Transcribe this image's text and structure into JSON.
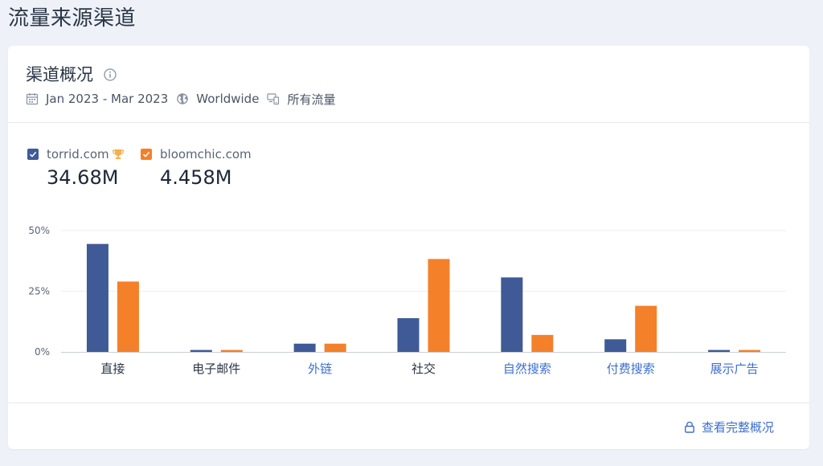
{
  "page": {
    "title": "流量来源渠道"
  },
  "card": {
    "title": "渠道概况",
    "filters": {
      "date_range": "Jan 2023 - Mar 2023",
      "region": "Worldwide",
      "traffic": "所有流量"
    },
    "footer_link": "查看完整概况"
  },
  "legend": [
    {
      "site": "torrid.com",
      "value": "34.68M",
      "color": "#3f5a97",
      "checked": true,
      "trophy": true
    },
    {
      "site": "bloomchic.com",
      "value": "4.458M",
      "color": "#f4802a",
      "checked": true,
      "trophy": false
    }
  ],
  "colors": {
    "series_1": "#3f5a97",
    "series_2": "#f4802a",
    "link": "#3d6fd0",
    "trophy": "#f3b24a"
  },
  "icons": {
    "info": "info-icon",
    "calendar": "calendar-icon",
    "globe": "globe-icon",
    "traffic": "devices-icon",
    "trophy": "trophy-icon",
    "lock": "lock-icon"
  },
  "chart_data": {
    "type": "bar",
    "categories": [
      "直接",
      "电子邮件",
      "外链",
      "社交",
      "自然搜索",
      "付费搜索",
      "展示广告"
    ],
    "category_is_link": [
      false,
      false,
      true,
      false,
      true,
      true,
      true
    ],
    "series": [
      {
        "name": "torrid.com",
        "values": [
          44.5,
          0.8,
          3.4,
          13.9,
          30.7,
          5.2,
          0.8
        ]
      },
      {
        "name": "bloomchic.com",
        "values": [
          29.0,
          0.8,
          3.4,
          38.3,
          7.0,
          19.0,
          0.8
        ]
      }
    ],
    "yticks": [
      "0%",
      "25%",
      "50%"
    ],
    "ytick_values": [
      0,
      25,
      50
    ],
    "ylim": [
      0,
      50
    ],
    "grid": true
  }
}
